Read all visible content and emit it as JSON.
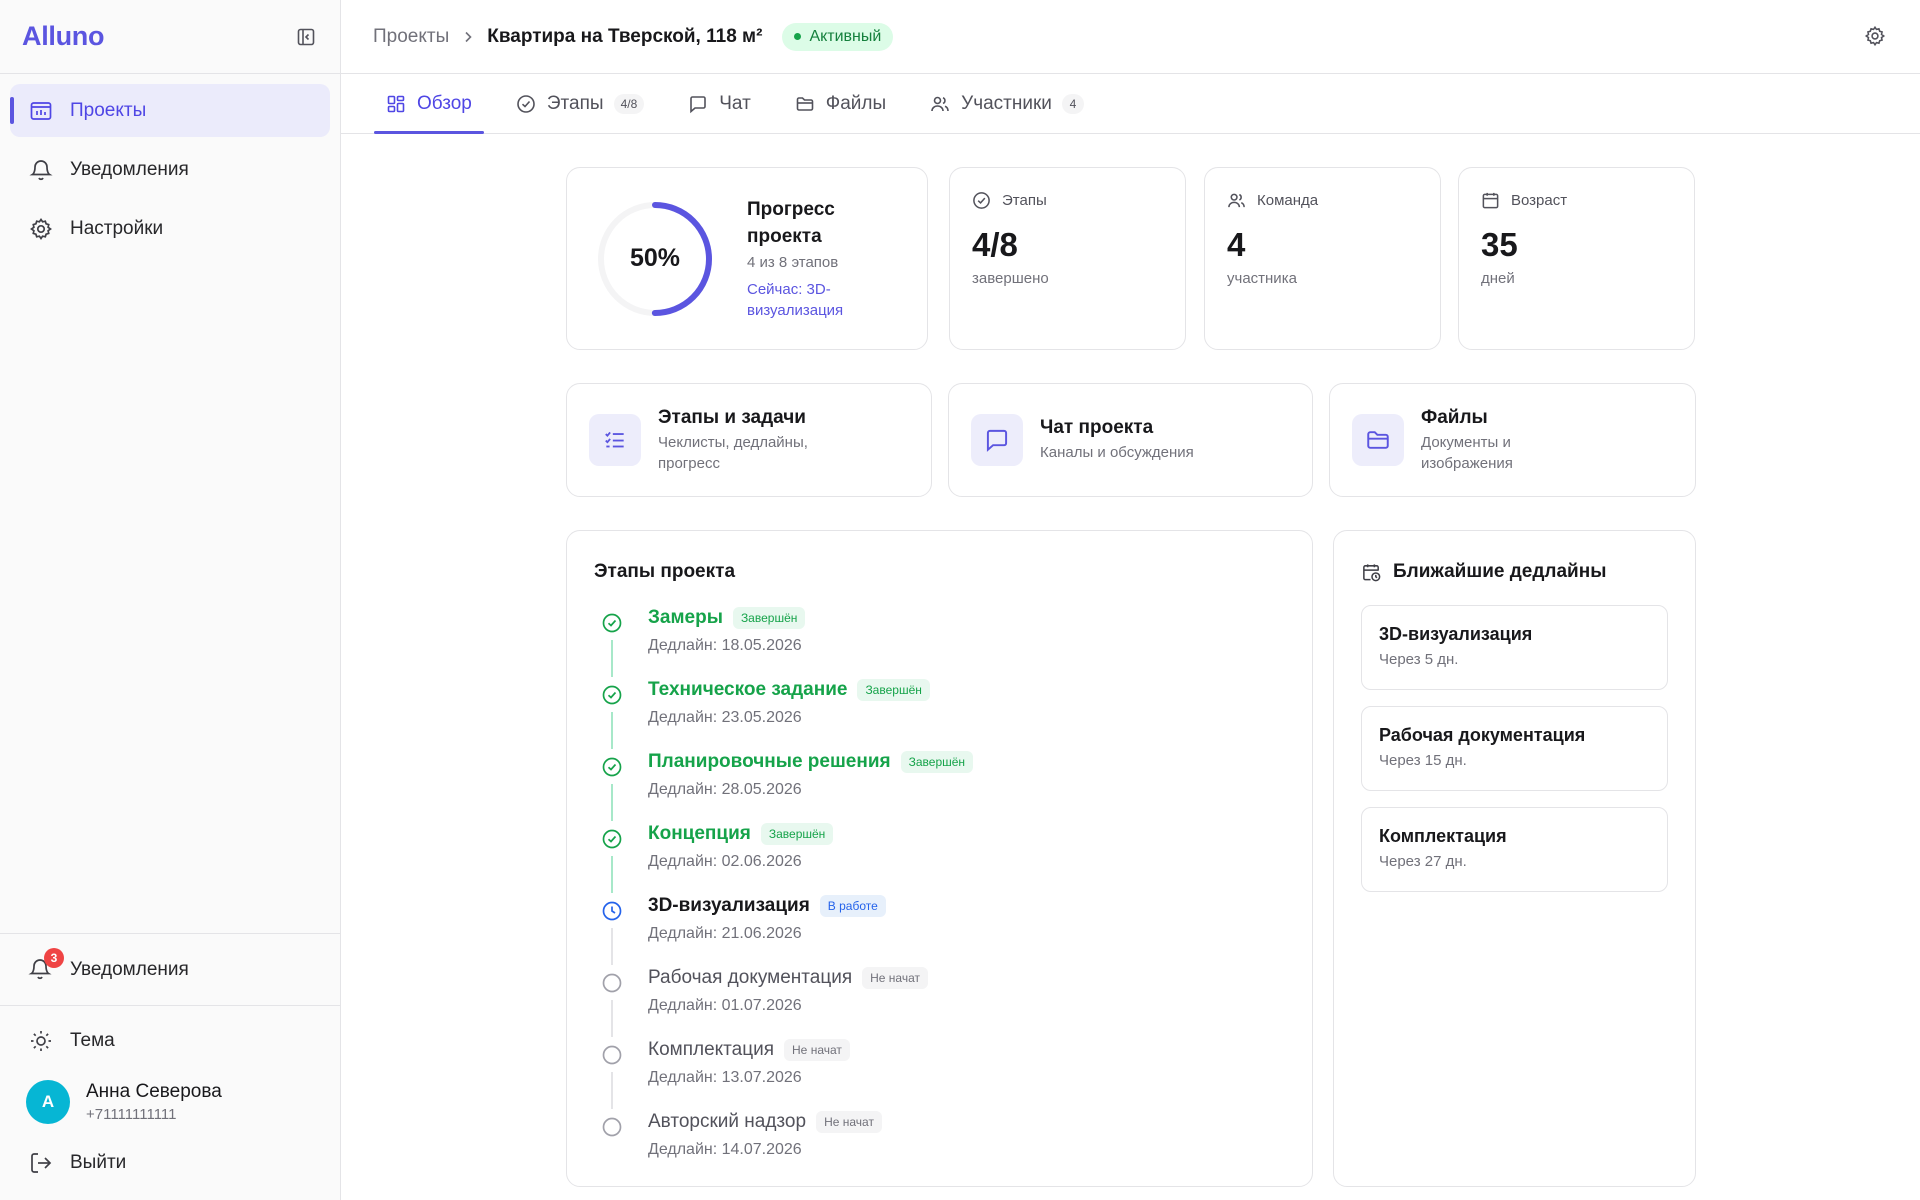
{
  "app": {
    "brand": "Alluno"
  },
  "sidebar": {
    "items": [
      {
        "label": "Проекты",
        "icon": "projects-icon",
        "active": true
      },
      {
        "label": "Уведомления",
        "icon": "bell-icon",
        "active": false
      },
      {
        "label": "Настройки",
        "icon": "gear-icon",
        "active": false
      }
    ],
    "notifications": {
      "label": "Уведомления",
      "count": "3"
    },
    "theme_label": "Тема",
    "user": {
      "initial": "А",
      "name": "Анна Северова",
      "phone": "+71111111111"
    },
    "logout_label": "Выйти"
  },
  "header": {
    "breadcrumb_root": "Проекты",
    "title": "Квартира на Тверской, 118 м²",
    "status": "Активный"
  },
  "tabs": [
    {
      "label": "Обзор",
      "count": "",
      "icon": "grid-icon",
      "active": true
    },
    {
      "label": "Этапы",
      "count": "4/8",
      "icon": "check-circle-icon",
      "active": false
    },
    {
      "label": "Чат",
      "count": "",
      "icon": "chat-icon",
      "active": false
    },
    {
      "label": "Файлы",
      "count": "",
      "icon": "folder-icon",
      "active": false
    },
    {
      "label": "Участники",
      "count": "4",
      "icon": "users-icon",
      "active": false
    }
  ],
  "progress": {
    "percent_label": "50%",
    "percent": 50,
    "title": "Прогресс проекта",
    "subtitle": "4 из 8 этапов",
    "current": "Сейчас: 3D-визуализация"
  },
  "stats": [
    {
      "label": "Этапы",
      "value": "4/8",
      "sub": "завершено",
      "icon": "check-circle-icon"
    },
    {
      "label": "Команда",
      "value": "4",
      "sub": "участника",
      "icon": "users-icon"
    },
    {
      "label": "Возраст",
      "value": "35",
      "sub": "дней",
      "icon": "calendar-icon"
    }
  ],
  "quick_links": [
    {
      "title": "Этапы и задачи",
      "sub": "Чеклисты, дедлайны, прогресс",
      "icon": "checklist-icon"
    },
    {
      "title": "Чат проекта",
      "sub": "Каналы и обсуждения",
      "icon": "chat-icon"
    },
    {
      "title": "Файлы",
      "sub": "Документы и изображения",
      "icon": "folder-icon"
    }
  ],
  "stages": {
    "title": "Этапы проекта",
    "items": [
      {
        "name": "Замеры",
        "status": "Завершён",
        "state": "done",
        "deadline": "Дедлайн: 18.05.2026"
      },
      {
        "name": "Техническое задание",
        "status": "Завершён",
        "state": "done",
        "deadline": "Дедлайн: 23.05.2026"
      },
      {
        "name": "Планировочные решения",
        "status": "Завершён",
        "state": "done",
        "deadline": "Дедлайн: 28.05.2026"
      },
      {
        "name": "Концепция",
        "status": "Завершён",
        "state": "done",
        "deadline": "Дедлайн: 02.06.2026"
      },
      {
        "name": "3D-визуализация",
        "status": "В работе",
        "state": "work",
        "deadline": "Дедлайн: 21.06.2026"
      },
      {
        "name": "Рабочая документация",
        "status": "Не начат",
        "state": "todo",
        "deadline": "Дедлайн: 01.07.2026"
      },
      {
        "name": "Комплектация",
        "status": "Не начат",
        "state": "todo",
        "deadline": "Дедлайн: 13.07.2026"
      },
      {
        "name": "Авторский надзор",
        "status": "Не начат",
        "state": "todo",
        "deadline": "Дедлайн: 14.07.2026"
      }
    ]
  },
  "deadlines": {
    "title": "Ближайшие дедлайны",
    "items": [
      {
        "title": "3D-визуализация",
        "sub": "Через 5 дн."
      },
      {
        "title": "Рабочая документация",
        "sub": "Через 15 дн."
      },
      {
        "title": "Комплектация",
        "sub": "Через 27 дн."
      }
    ]
  },
  "colors": {
    "accent": "#5b55e0",
    "success": "#16a34a",
    "info": "#2563eb",
    "danger": "#ef4444"
  }
}
